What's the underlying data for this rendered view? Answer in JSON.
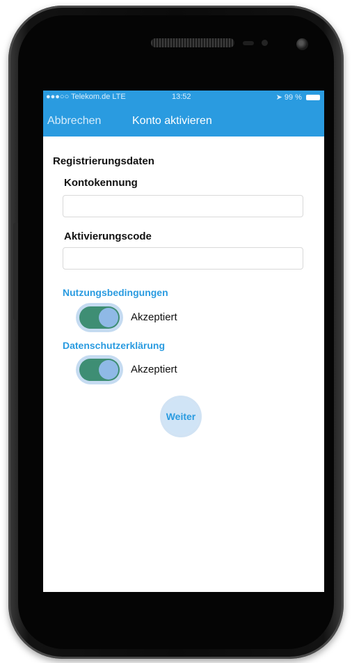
{
  "status_bar": {
    "carrier": "●●●○○ Telekom.de  LTE",
    "time": "13:52",
    "battery": "99 %"
  },
  "nav_bar": {
    "cancel_label": "Abbrechen",
    "title": "Konto aktivieren"
  },
  "form": {
    "section_title": "Registrierungsdaten",
    "account_id_label": "Kontokennung",
    "account_id_value": "",
    "activation_code_label": "Aktivierungscode",
    "activation_code_value": ""
  },
  "terms": {
    "heading": "Nutzungsbedingungen",
    "toggle_label": "Akzeptiert",
    "toggle_on": true
  },
  "privacy": {
    "heading": "Datenschutzerklärung",
    "toggle_label": "Akzeptiert",
    "toggle_on": true
  },
  "continue_label": "Weiter",
  "colors": {
    "accent": "#2a9be0",
    "toggle_on": "#3e8e74"
  }
}
